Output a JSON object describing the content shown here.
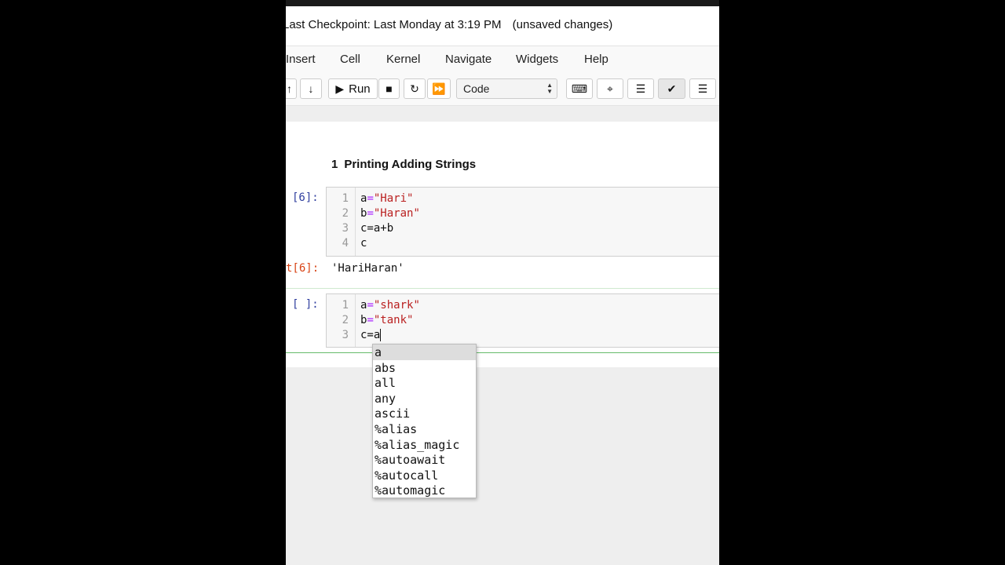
{
  "header": {
    "checkpoint": "Last Checkpoint: Last Monday at 3:19 PM",
    "unsaved": "(unsaved changes)"
  },
  "menu": [
    "Insert",
    "Cell",
    "Kernel",
    "Navigate",
    "Widgets",
    "Help"
  ],
  "toolbar": {
    "run_label": "Run",
    "cell_type": "Code"
  },
  "notebook": {
    "heading_number": "1",
    "heading_text": "Printing Adding Strings",
    "cell1_prompt": "[6]:",
    "cell1_lines": [
      {
        "n": "1",
        "pre": "a",
        "op": "=",
        "str": "\"Hari\""
      },
      {
        "n": "2",
        "pre": "b",
        "op": "=",
        "str": "\"Haran\""
      },
      {
        "n": "3",
        "text": "c=a+b"
      },
      {
        "n": "4",
        "text": "c"
      }
    ],
    "out_prompt": "t[6]:",
    "output": "'HariHaran'",
    "cell2_prompt": "[ ]:",
    "cell2_lines": [
      {
        "n": "1",
        "pre": "a",
        "op": "=",
        "str": "\"shark\""
      },
      {
        "n": "2",
        "pre": "b",
        "op": "=",
        "str": "\"tank\""
      },
      {
        "n": "3",
        "text": "c=a"
      }
    ]
  },
  "autocomplete": {
    "items": [
      "a",
      "abs",
      "all",
      "any",
      "ascii",
      "%alias",
      "%alias_magic",
      "%autoawait",
      "%autocall",
      "%automagic"
    ],
    "selected_index": 0
  },
  "colors": {
    "prompt_in": "#303f9f",
    "prompt_out": "#d84315",
    "string": "#ba2121",
    "operator": "#aa22ff",
    "active_cell_border": "#66bb6a"
  }
}
